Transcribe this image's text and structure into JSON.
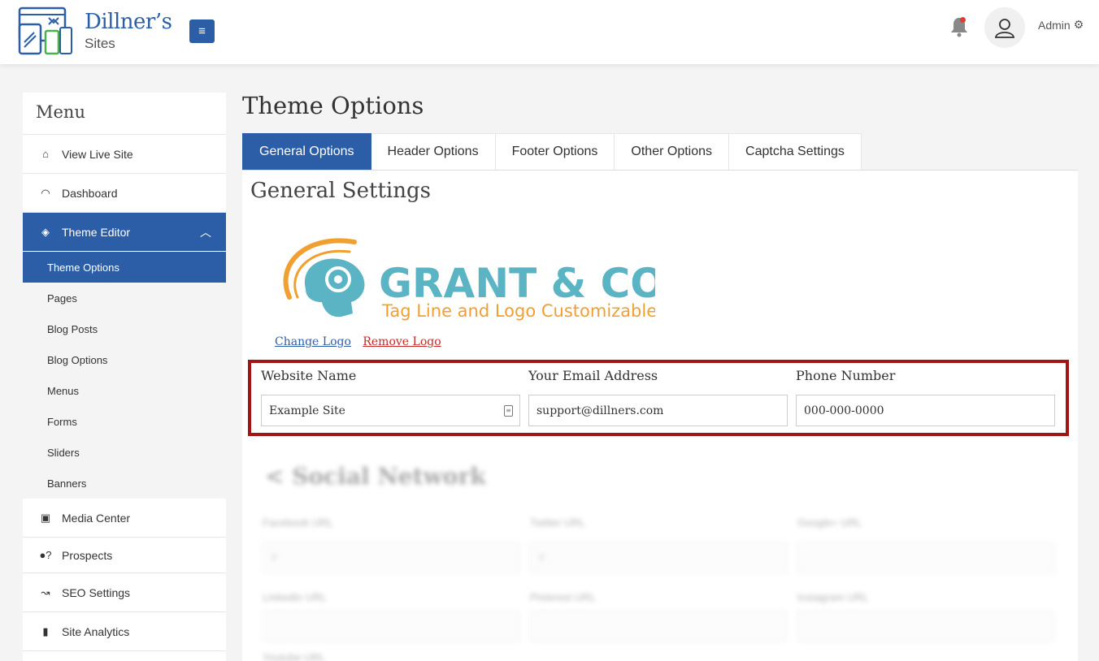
{
  "brand": {
    "title": "Dillner’s",
    "subtitle": "Sites"
  },
  "header": {
    "user_label": "Admin"
  },
  "sidebar": {
    "heading": "Menu",
    "items": [
      {
        "label": "View Live Site",
        "icon": "home-icon"
      },
      {
        "label": "Dashboard",
        "icon": "gauge-icon"
      },
      {
        "label": "Theme Editor",
        "icon": "layers-icon"
      },
      {
        "label": "Media Center",
        "icon": "image-icon"
      },
      {
        "label": "Prospects",
        "icon": "user-question-icon"
      },
      {
        "label": "SEO Settings",
        "icon": "trend-icon"
      },
      {
        "label": "Site Analytics",
        "icon": "bar-chart-icon"
      }
    ],
    "sub_items": [
      "Theme Options",
      "Pages",
      "Blog Posts",
      "Blog Options",
      "Menus",
      "Forms",
      "Sliders",
      "Banners"
    ]
  },
  "page": {
    "title": "Theme Options",
    "tabs": [
      "General Options",
      "Header Options",
      "Footer Options",
      "Other Options",
      "Captcha Settings"
    ],
    "section_title": "General Settings",
    "logo": {
      "name": "GRANT & CO.",
      "tagline": "Tag Line and Logo Customizable"
    },
    "logo_links": {
      "change": "Change Logo",
      "remove": "Remove Logo"
    },
    "fields": {
      "website_name": {
        "label": "Website Name",
        "value": "Example Site"
      },
      "email": {
        "label": "Your Email Address",
        "value": "support@dillners.com"
      },
      "phone": {
        "label": "Phone Number",
        "value": "000-000-0000"
      }
    }
  },
  "blurred": {
    "title": "Social Network",
    "labels": [
      "Facebook URL",
      "Twitter URL",
      "Google+ URL",
      "LinkedIn URL",
      "Pinterest URL",
      "Instagram URL",
      "Youtube URL"
    ],
    "values": [
      "#",
      "#"
    ]
  },
  "colors": {
    "primary": "#2c5ea8",
    "highlight_border": "#a31515",
    "remove_link": "#c62828",
    "logo_teal": "#5ab4c4",
    "logo_orange": "#f0a030"
  }
}
